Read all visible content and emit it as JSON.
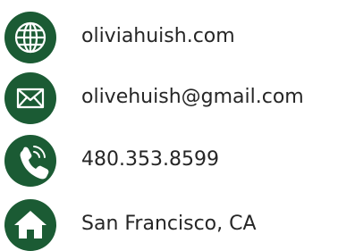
{
  "contacts": {
    "website": {
      "text": "oliviahuish.com",
      "icon": "globe-icon"
    },
    "email": {
      "text": "olivehuish@gmail.com",
      "icon": "envelope-icon"
    },
    "phone": {
      "text": "480.353.8599",
      "icon": "phone-icon"
    },
    "address": {
      "text": "San Francisco, CA",
      "icon": "home-icon"
    }
  },
  "colors": {
    "icon_background": "#1b5b34",
    "icon_foreground": "#ffffff",
    "text": "#262626"
  }
}
